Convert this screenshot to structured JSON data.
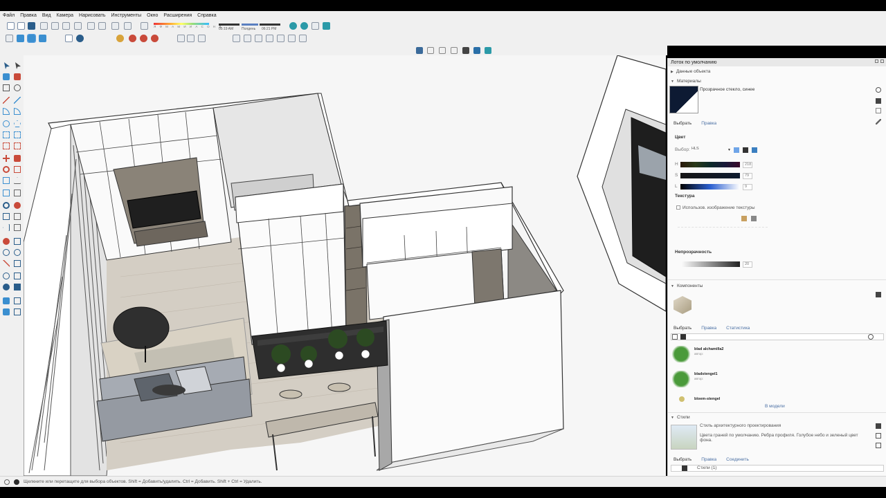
{
  "menu": [
    "Файл",
    "Правка",
    "Вид",
    "Камера",
    "Нарисовать",
    "Инструменты",
    "Окно",
    "Расширения",
    "Справка"
  ],
  "shadow": {
    "months": "Я Ф М А М И И А С О Н Д",
    "time_start": "05:19 AM",
    "time_mid": "Полдень",
    "time_end": "06:21 PM"
  },
  "status": {
    "hint": "Щелкните или перетащите для выбора объектов. Shift = Добавить/удалить. Ctrl = Добавить. Shift + Ctrl = Удалить."
  },
  "tray": {
    "title": "Лоток по умолчанию",
    "entity_info": "Данные объекта",
    "materials": {
      "header": "Материалы",
      "name": "Прозрачное стекло, синее",
      "tab_select": "Выбрать",
      "tab_edit": "Правка",
      "color_label": "Цвет",
      "picker_label": "Выбор:",
      "picker_value": "HLS",
      "h_label": "H",
      "h_value": "218",
      "s_label": "S",
      "s_value": "79",
      "l_label": "L",
      "l_value": "9",
      "texture_label": "Текстура",
      "texture_checkbox": "Использов. изображение текстуры",
      "opacity_label": "Непрозрачность",
      "opacity_value": "20",
      "accent": "#1a2a4a"
    },
    "components": {
      "header": "Компоненты",
      "tab_select": "Выбрать",
      "tab_edit": "Правка",
      "tab_stats": "Статистика",
      "items": [
        {
          "name": "blad alchamilla2",
          "author": "автор:"
        },
        {
          "name": "bladstengel1",
          "author": "автор:"
        },
        {
          "name": "bloem-stengel",
          "author": ""
        }
      ],
      "footer": "В модели"
    },
    "styles": {
      "header": "Стили",
      "name": "Стиль архитектурного проектирования",
      "description": "Цвета граней по умолчанию. Ребра профиля. Голубое небо и зеленый цвет фона.",
      "tab_select": "Выбрать",
      "tab_edit": "Правка",
      "tab_mix": "Соединить",
      "dropdown": "Стили (1)"
    }
  }
}
